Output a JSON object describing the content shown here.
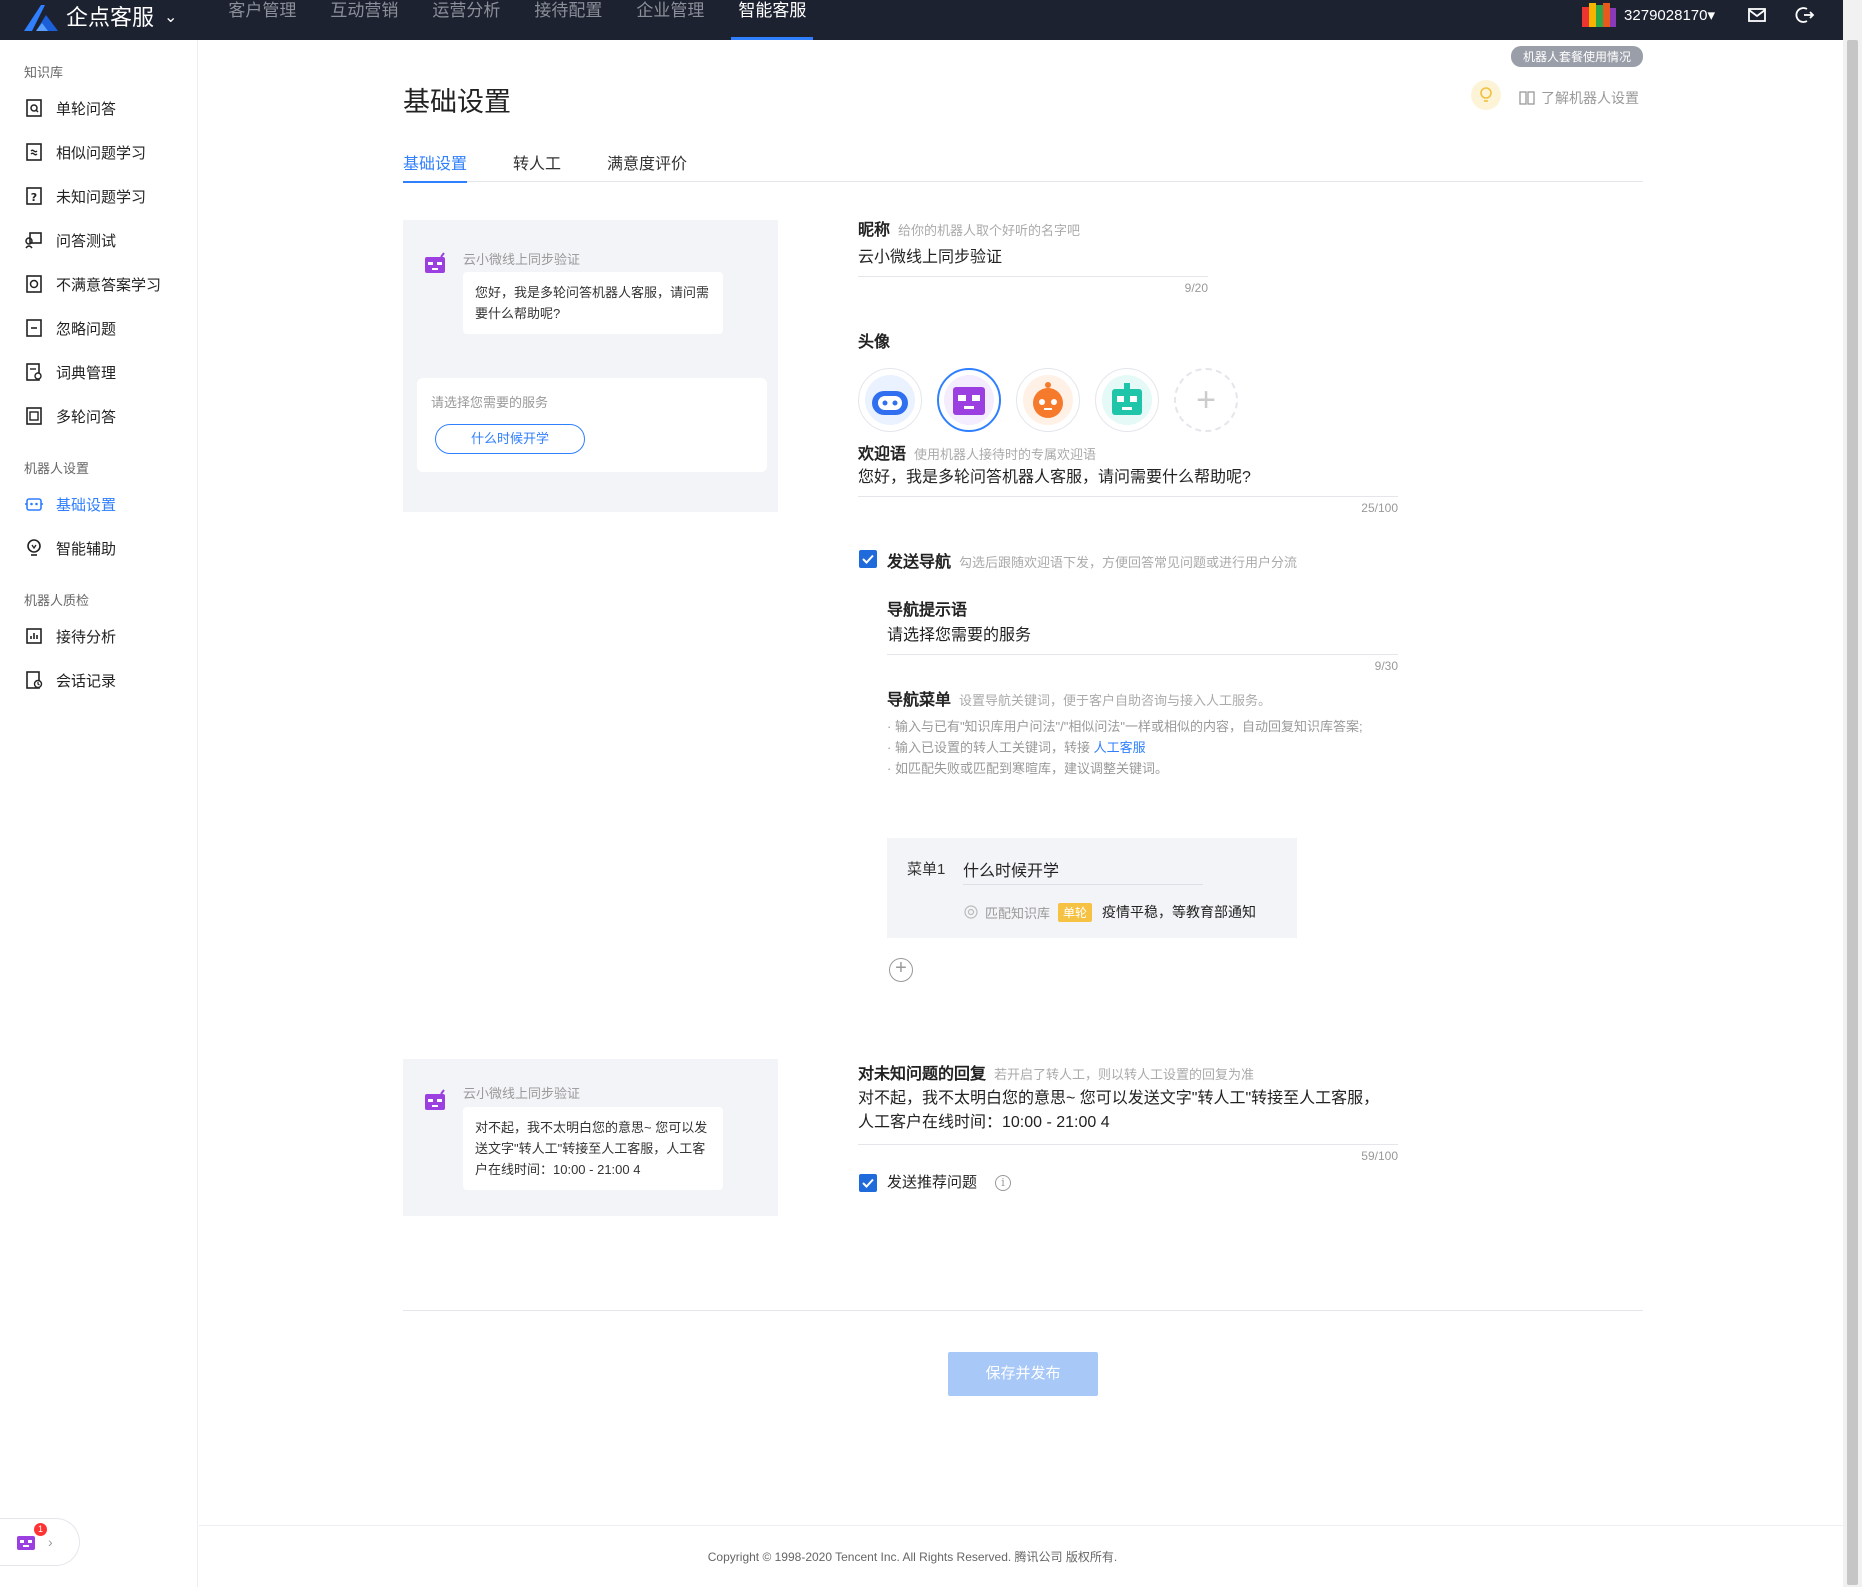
{
  "topnav": {
    "brand": "企点客服",
    "items": [
      "客户管理",
      "互动营销",
      "运营分析",
      "接待配置",
      "企业管理",
      "智能客服"
    ],
    "active_index": 5,
    "user_id": "3279028170▾"
  },
  "sidebar": {
    "groups": [
      {
        "title": "知识库",
        "items": [
          "单轮问答",
          "相似问题学习",
          "未知问题学习",
          "问答测试",
          "不满意答案学习",
          "忽略问题",
          "词典管理",
          "多轮问答"
        ]
      },
      {
        "title": "机器人设置",
        "items": [
          "基础设置",
          "智能辅助"
        ]
      },
      {
        "title": "机器人质检",
        "items": [
          "接待分析",
          "会话记录"
        ]
      }
    ],
    "active": "基础设置",
    "widget_badge": "1"
  },
  "page": {
    "title": "基础设置",
    "package_badge": "机器人套餐使用情况",
    "help_link": "了解机器人设置",
    "tabs": [
      "基础设置",
      "转人工",
      "满意度评价"
    ],
    "active_tab": 0
  },
  "preview1": {
    "bot_name": "云小微线上同步验证",
    "welcome": "您好，我是多轮问答机器人客服，请问需要什么帮助呢?",
    "nav_hint": "请选择您需要的服务",
    "nav_button": "什么时候开学"
  },
  "preview2": {
    "bot_name": "云小微线上同步验证",
    "reply": "对不起，我不太明白您的意思~ 您可以发送文字\"转人工\"转接至人工客服，人工客户在线时间：10:00 - 21:00 4"
  },
  "form": {
    "nickname": {
      "label": "昵称",
      "hint": "给你的机器人取个好听的名字吧",
      "value": "云小微线上同步验证",
      "counter": "9/20"
    },
    "avatar": {
      "label": "头像",
      "options": [
        "robot-blue",
        "robot-purple",
        "robot-orange",
        "robot-teal"
      ],
      "selected": 1
    },
    "welcome": {
      "label": "欢迎语",
      "hint": "使用机器人接待时的专属欢迎语",
      "value": "您好，我是多轮问答机器人客服，请问需要什么帮助呢?",
      "counter": "25/100"
    },
    "send_nav": {
      "label": "发送导航",
      "hint": "勾选后跟随欢迎语下发，方便回答常见问题或进行用户分流",
      "checked": true
    },
    "nav_prompt": {
      "label": "导航提示语",
      "value": "请选择您需要的服务",
      "counter": "9/30"
    },
    "nav_menu": {
      "label": "导航菜单",
      "hint": "设置导航关键词，便于客户自助咨询与接入人工服务。",
      "tip1": "· 输入与已有\"知识库用户问法\"/\"相似问法\"一样或相似的内容，自动回复知识库答案;",
      "tip2_prefix": "· 输入已设置的转人工关键词，转接 ",
      "tip2_link": "人工客服",
      "tip3": "· 如匹配失败或匹配到寒暄库，建议调整关键词。",
      "items": [
        {
          "label": "菜单1",
          "value": "什么时候开学",
          "match_label": "匹配知识库",
          "tag": "单轮",
          "match_value": "疫情平稳，等教育部通知"
        }
      ]
    },
    "unknown_reply": {
      "label": "对未知问题的回复",
      "hint": "若开启了转人工，则以转人工设置的回复为准",
      "line1": "对不起，我不太明白您的意思~ 您可以发送文字\"转人工\"转接至人工客服，",
      "line2": "人工客户在线时间：10:00 - 21:00 4",
      "counter": "59/100"
    },
    "send_recommend": {
      "label": "发送推荐问题",
      "checked": true,
      "info_icon": "i"
    },
    "save_button": "保存并发布"
  },
  "footer": "Copyright © 1998-2020 Tencent Inc. All Rights Reserved. 腾讯公司 版权所有.",
  "colors": {
    "topbar": "#1d2230",
    "accent": "#2f7fff",
    "save_disabled": "#a8c8f8",
    "preview_bg": "#f3f4f7"
  }
}
